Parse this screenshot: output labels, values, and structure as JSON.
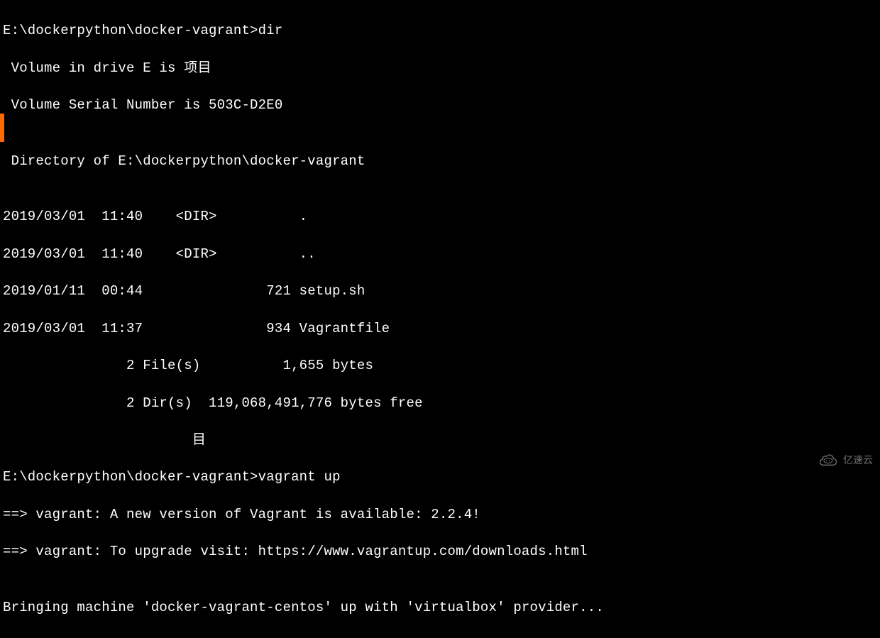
{
  "terminal": {
    "lines": [
      "E:\\dockerpython\\docker-vagrant>dir",
      " Volume in drive E is 项目",
      " Volume Serial Number is 503C-D2E0",
      "",
      " Directory of E:\\dockerpython\\docker-vagrant",
      "",
      "2019/03/01  11:40    <DIR>          .",
      "2019/03/01  11:40    <DIR>          ..",
      "2019/01/11  00:44               721 setup.sh",
      "2019/03/01  11:37               934 Vagrantfile",
      "               2 File(s)          1,655 bytes",
      "               2 Dir(s)  119,068,491,776 bytes free",
      "                       目",
      "E:\\dockerpython\\docker-vagrant>vagrant up",
      "==> vagrant: A new version of Vagrant is available: 2.2.4!",
      "==> vagrant: To upgrade visit: https://www.vagrantup.com/downloads.html",
      "",
      "Bringing machine 'docker-vagrant-centos' up with 'virtualbox' provider..."
    ]
  },
  "watermark": {
    "text": "亿速云"
  }
}
